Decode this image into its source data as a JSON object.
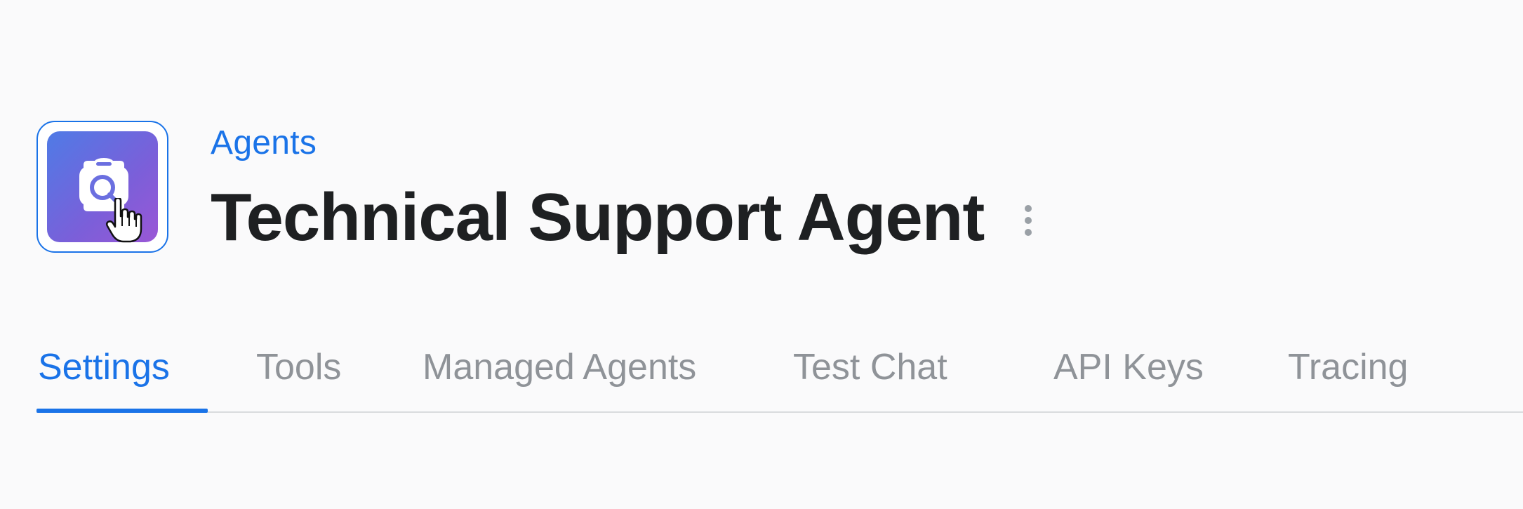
{
  "header": {
    "breadcrumb": "Agents",
    "title": "Technical Support Agent",
    "avatar_icon": "agent-search-icon",
    "menu_icon": "kebab-menu-icon"
  },
  "tabs": [
    {
      "label": "Settings",
      "active": true
    },
    {
      "label": "Tools",
      "active": false
    },
    {
      "label": "Managed Agents",
      "active": false
    },
    {
      "label": "Test Chat",
      "active": false
    },
    {
      "label": "API Keys",
      "active": false
    },
    {
      "label": "Tracing",
      "active": false
    }
  ],
  "colors": {
    "accent": "#1a73e8",
    "title": "#1e2022",
    "tab_inactive": "#8f9398",
    "avatar_gradient_start": "#4f7be6",
    "avatar_gradient_end": "#9a57d6"
  }
}
